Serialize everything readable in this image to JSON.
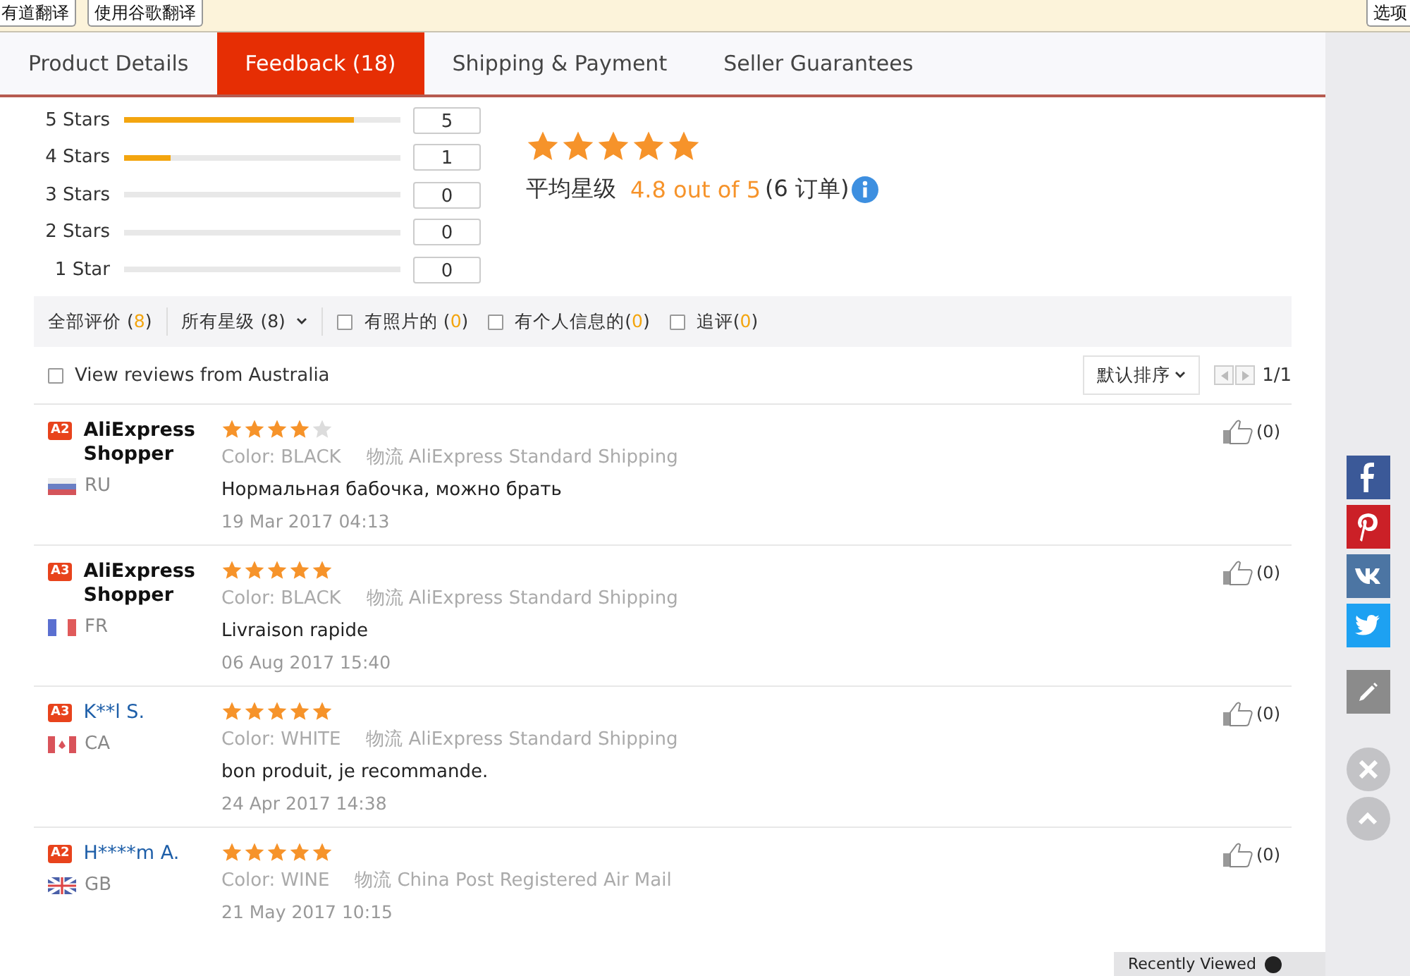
{
  "translate_bar": {
    "buttons": [
      "有道翻译",
      "使用谷歌翻译"
    ],
    "options_button": "选项"
  },
  "tabs": [
    {
      "label": "Product Details",
      "selected": false
    },
    {
      "label": "Feedback (18)",
      "selected": true
    },
    {
      "label": "Shipping & Payment",
      "selected": false
    },
    {
      "label": "Seller Guarantees",
      "selected": false
    }
  ],
  "rating_breakdown": [
    {
      "label": "5 Stars",
      "level": 0.83,
      "count": "5"
    },
    {
      "label": "4 Stars",
      "level": 0.17,
      "count": "1"
    },
    {
      "label": "3 Stars",
      "level": 0,
      "count": "0"
    },
    {
      "label": "2 Stars",
      "level": 0,
      "count": "0"
    },
    {
      "label": "1 Star",
      "level": 0,
      "count": "0"
    }
  ],
  "summary": {
    "stars": 5,
    "label": "平均星级",
    "score": "4.8 out of 5",
    "orders": "(6 订单)"
  },
  "filters": [
    {
      "kind": "tab",
      "label": "全部评价",
      "count": "(8)",
      "spaced": true
    },
    {
      "kind": "dropdown",
      "label": "所有星级 (8)"
    },
    {
      "kind": "checkbox",
      "label": "有照片的",
      "count": "(0)",
      "spaced": true,
      "checked": false
    },
    {
      "kind": "checkbox",
      "label": "有个人信息的",
      "count": "(0)",
      "spaced": false,
      "checked": false
    },
    {
      "kind": "checkbox",
      "label": "追评",
      "count": "(0)",
      "spaced": false,
      "checked": false
    }
  ],
  "sort_bar": {
    "country_filter": {
      "label": "View reviews from Australia",
      "checked": false
    },
    "sort_button": "默认排序",
    "page": "1/1"
  },
  "reviews": [
    {
      "badge": "A2",
      "name": "AliExpress Shopper",
      "kind": "anonymous",
      "country": {
        "kind": "ru",
        "code": "RU"
      },
      "stars": 4,
      "color_label": "Color:",
      "product_color": "BLACK",
      "shipping_label": "物流",
      "shipping": "AliExpress Standard Shipping",
      "text": "Нормальная бабочка, можно брать",
      "date": "19 Mar 2017 04:13",
      "likes": "(0)"
    },
    {
      "badge": "A3",
      "name": "AliExpress Shopper",
      "kind": "anonymous",
      "country": {
        "kind": "fr",
        "code": "FR"
      },
      "stars": 5,
      "color_label": "Color:",
      "product_color": "BLACK",
      "shipping_label": "物流",
      "shipping": "AliExpress Standard Shipping",
      "text": "Livraison rapide",
      "date": "06 Aug 2017 15:40",
      "likes": "(0)"
    },
    {
      "badge": "A3",
      "name": "K**l S.",
      "kind": "member",
      "country": {
        "kind": "ca",
        "code": "CA"
      },
      "stars": 5,
      "color_label": "Color:",
      "product_color": "WHITE",
      "shipping_label": "物流",
      "shipping": "AliExpress Standard Shipping",
      "text": "bon produit, je recommande.",
      "date": "24 Apr 2017 14:38",
      "likes": "(0)"
    },
    {
      "badge": "A2",
      "name": "H****m A.",
      "kind": "member",
      "country": {
        "kind": "gb",
        "code": "GB"
      },
      "stars": 5,
      "color_label": "Color:",
      "product_color": "WINE",
      "shipping_label": "物流",
      "shipping": "China Post Registered Air Mail",
      "date": "21 May 2017 10:15",
      "likes": "(0)"
    }
  ],
  "share_bar": [
    {
      "kind": "facebook"
    },
    {
      "kind": "pinterest"
    },
    {
      "kind": "vk"
    },
    {
      "kind": "twitter"
    }
  ],
  "recently_viewed": {
    "label": "Recently Viewed"
  }
}
